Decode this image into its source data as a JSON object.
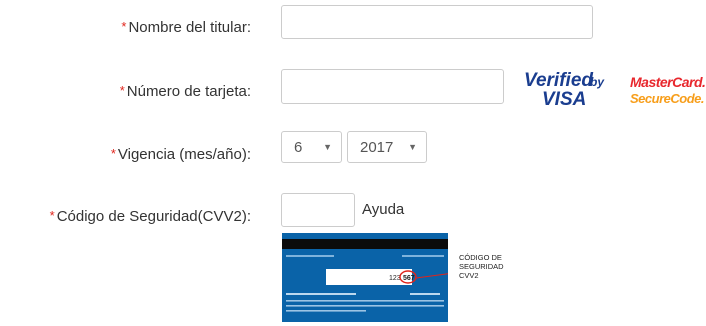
{
  "form": {
    "required_mark": "*",
    "holder_label": "Nombre del titular:",
    "card_number_label": "Número de tarjeta:",
    "expiry_label": "Vigencia (mes/año):",
    "cvv_label": "Código de Seguridad(CVV2):",
    "holder_value": "",
    "card_number_value": "",
    "expiry_month": "6",
    "expiry_year": "2017",
    "cvv_value": "",
    "help_link": "Ayuda"
  },
  "badges": {
    "verified_line1": "Verified",
    "verified_by": "by",
    "verified_line2": "VISA",
    "mc_line1": "MasterCard.",
    "mc_line2": "SecureCode."
  },
  "cvv_card": {
    "digits_plain": "123",
    "digits_circled": "567",
    "caption_line1": "CÓDIGO DE",
    "caption_line2": "SEGURIDAD",
    "caption_line3": "CVV2"
  },
  "colors": {
    "required": "#e0241b",
    "visa_blue": "#1a3d8f",
    "mastercard_red": "#e8272d",
    "mastercard_orange": "#f79e1b",
    "card_blue": "#0a63a8"
  }
}
